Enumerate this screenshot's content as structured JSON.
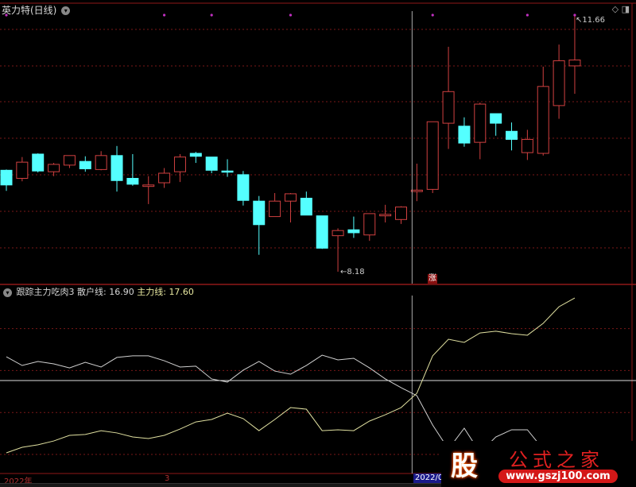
{
  "header": {
    "title": "英力特(日线)",
    "menu_icon": "chevron-down-icon"
  },
  "indicator": {
    "name": "跟踪主力吃肉3",
    "retail_label": "散户线:",
    "retail_value": "16.90",
    "main_label": "主力线:",
    "main_value": "17.60"
  },
  "markers": {
    "low_label": "8.18",
    "high_label": "11.66",
    "signal": "涨"
  },
  "time_axis": {
    "labels": [
      "2022年",
      "3"
    ],
    "selected": "2022/0"
  },
  "watermark": {
    "logo_char": "股",
    "site_name": "公式之家",
    "url": "www.gszj100.com"
  },
  "colors": {
    "up": "#d04040",
    "down": "#54ffff",
    "retail": "#d0d0d0",
    "main": "#e0e0a0",
    "grid": "#7a1818",
    "dot": "#c030c0"
  },
  "chart_data": [
    {
      "type": "candlestick",
      "title": "英力特(日线)",
      "ylim": [
        8.18,
        11.66
      ],
      "grid": true,
      "signal_dots_index": [
        0,
        10,
        13,
        18,
        27,
        33,
        36
      ],
      "cursor_index": 26,
      "ohlc": [
        [
          9.56,
          9.57,
          9.28,
          9.36
        ],
        [
          9.45,
          9.74,
          9.41,
          9.67
        ],
        [
          9.78,
          9.79,
          9.53,
          9.55
        ],
        [
          9.54,
          9.66,
          9.48,
          9.64
        ],
        [
          9.63,
          9.76,
          9.59,
          9.76
        ],
        [
          9.68,
          9.75,
          9.54,
          9.58
        ],
        [
          9.57,
          9.82,
          9.56,
          9.76
        ],
        [
          9.76,
          9.89,
          9.27,
          9.42
        ],
        [
          9.45,
          9.78,
          9.35,
          9.37
        ],
        [
          9.34,
          9.48,
          9.1,
          9.36
        ],
        [
          9.39,
          9.59,
          9.32,
          9.52
        ],
        [
          9.54,
          9.78,
          9.4,
          9.74
        ],
        [
          9.79,
          9.81,
          9.66,
          9.75
        ],
        [
          9.74,
          9.74,
          9.52,
          9.56
        ],
        [
          9.55,
          9.71,
          9.47,
          9.54
        ],
        [
          9.5,
          9.55,
          9.08,
          9.15
        ],
        [
          9.14,
          9.21,
          8.41,
          8.82
        ],
        [
          8.93,
          9.25,
          8.93,
          9.14
        ],
        [
          9.14,
          9.25,
          8.85,
          9.24
        ],
        [
          9.18,
          9.27,
          8.95,
          8.95
        ],
        [
          8.94,
          8.94,
          8.49,
          8.5
        ],
        [
          8.67,
          8.77,
          8.18,
          8.74
        ],
        [
          8.75,
          8.93,
          8.64,
          8.71
        ],
        [
          8.68,
          8.97,
          8.6,
          8.97
        ],
        [
          8.94,
          9.09,
          8.85,
          8.96
        ],
        [
          8.89,
          9.07,
          8.83,
          9.06
        ],
        [
          9.27,
          9.65,
          9.14,
          9.29
        ],
        [
          9.3,
          10.22,
          9.25,
          10.22
        ],
        [
          10.2,
          11.24,
          9.85,
          10.63
        ],
        [
          10.16,
          10.28,
          9.88,
          9.93
        ],
        [
          9.94,
          10.48,
          9.71,
          10.46
        ],
        [
          10.33,
          10.33,
          10.03,
          10.2
        ],
        [
          10.09,
          10.21,
          9.83,
          9.98
        ],
        [
          9.8,
          10.11,
          9.7,
          9.98
        ],
        [
          9.79,
          10.97,
          9.76,
          10.7
        ],
        [
          10.44,
          11.27,
          10.26,
          11.05
        ],
        [
          10.98,
          11.66,
          10.6,
          11.06
        ]
      ]
    },
    {
      "type": "line",
      "title": "跟踪主力吃肉3",
      "ylim": [
        0,
        100
      ],
      "reference_line": 52.3,
      "gridlines": [
        82,
        58,
        34,
        10
      ],
      "series": [
        {
          "name": "散户线",
          "values": [
            65.9,
            60.9,
            63.2,
            61.8,
            59.5,
            62.7,
            60,
            65.5,
            66.4,
            66.4,
            63.6,
            60,
            60.5,
            53.2,
            51.4,
            58.2,
            63.2,
            57.7,
            55.9,
            60.9,
            66.8,
            64.1,
            65,
            59.5,
            53.2,
            48.2,
            43.6,
            26.8,
            13,
            25,
            11,
            20,
            24.1,
            24.1,
            13,
            11,
            9
          ]
        },
        {
          "name": "主力线",
          "values": [
            10.9,
            14.1,
            15.5,
            17.7,
            20.9,
            21.4,
            23.6,
            22.3,
            20,
            19.1,
            20.9,
            24.5,
            28.6,
            30,
            33.6,
            30.5,
            23.6,
            30,
            36.8,
            35.9,
            23.6,
            24.1,
            23.6,
            29.1,
            32.7,
            36.8,
            45,
            66.4,
            75.9,
            74.1,
            79.5,
            80.5,
            79.1,
            78.2,
            85,
            94.5,
            99.5
          ]
        }
      ]
    }
  ]
}
